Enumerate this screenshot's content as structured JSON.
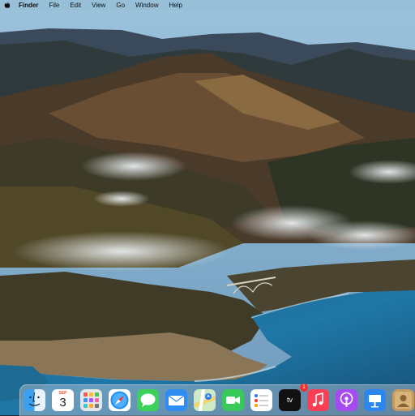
{
  "menubar": {
    "app_name": "Finder",
    "items": [
      "File",
      "Edit",
      "View",
      "Go",
      "Window",
      "Help"
    ]
  },
  "dock": {
    "calendar": {
      "month": "SEP",
      "day": "3"
    },
    "reminders_badge": "1",
    "tv_label": "tv",
    "icons": [
      "finder-icon",
      "calendar-icon",
      "launchpad-icon",
      "safari-icon",
      "messages-icon",
      "mail-icon",
      "maps-icon",
      "facetime-icon",
      "reminders-icon",
      "tv-icon",
      "music-icon",
      "podcasts-icon",
      "keynote-icon",
      "contacts-icon"
    ]
  },
  "colors": {
    "menubar_bg": "#96bed7",
    "sea": "#1f6e9a",
    "sky": "#8fb8d6"
  }
}
